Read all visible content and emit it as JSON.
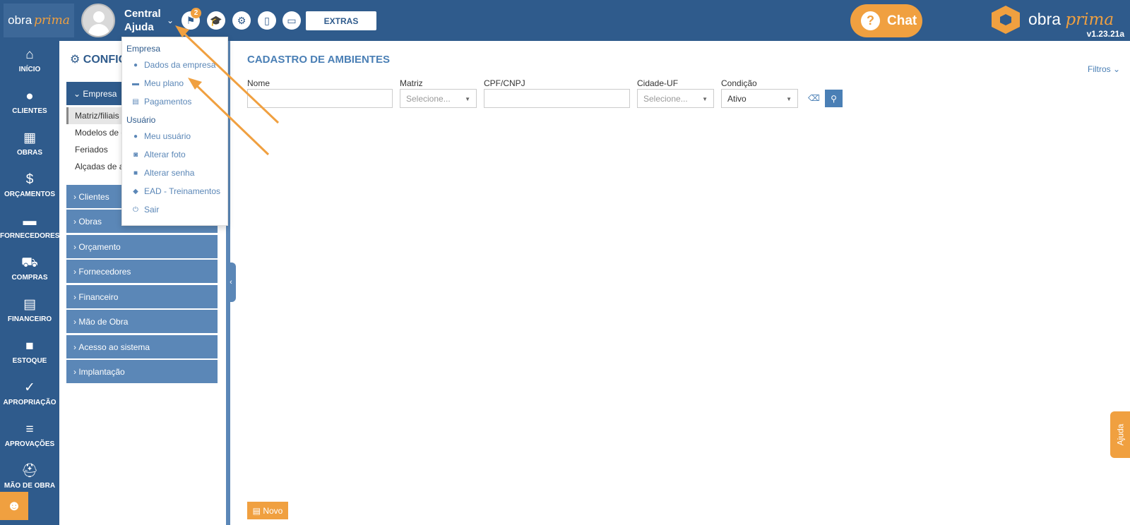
{
  "header": {
    "brand_left": {
      "text": "obra",
      "script": "prima"
    },
    "user": {
      "line1": "Central",
      "line2": "Ajuda"
    },
    "notification_count": "2",
    "extras_label": "EXTRAS",
    "chat_label": "Chat",
    "brand_right": {
      "text": "obra",
      "script": "prima"
    },
    "version": "v1.23.21a"
  },
  "leftnav": [
    {
      "label": "INÍCIO",
      "icon": "home-icon"
    },
    {
      "label": "CLIENTES",
      "icon": "user-icon"
    },
    {
      "label": "OBRAS",
      "icon": "building-icon"
    },
    {
      "label": "ORÇAMENTOS",
      "icon": "budget-doc-icon"
    },
    {
      "label": "FORNECEDORES",
      "icon": "truck-icon"
    },
    {
      "label": "COMPRAS",
      "icon": "cart-icon"
    },
    {
      "label": "FINANCEIRO",
      "icon": "calculator-icon"
    },
    {
      "label": "ESTOQUE",
      "icon": "box-icon"
    },
    {
      "label": "APROPRIAÇÃO",
      "icon": "check-doc-icon"
    },
    {
      "label": "APROVAÇÕES",
      "icon": "list-check-icon"
    },
    {
      "label": "MÃO DE OBRA",
      "icon": "hardhat-icon"
    }
  ],
  "config": {
    "title": "CONFIG",
    "sections": [
      {
        "label": "Empresa",
        "expanded": true
      },
      {
        "label": "Clientes"
      },
      {
        "label": "Obras"
      },
      {
        "label": "Orçamento"
      },
      {
        "label": "Fornecedores"
      },
      {
        "label": "Financeiro"
      },
      {
        "label": "Mão de Obra"
      },
      {
        "label": "Acesso ao sistema"
      },
      {
        "label": "Implantação"
      }
    ],
    "subitems": [
      "Matriz/filiais",
      "Modelos de e",
      "Feriados",
      "Alçadas de a"
    ]
  },
  "main": {
    "title": "CADASTRO DE AMBIENTES",
    "filters_label": "Filtros",
    "fields": {
      "nome": {
        "label": "Nome",
        "value": ""
      },
      "matriz": {
        "label": "Matriz",
        "value": "Selecione..."
      },
      "cpf": {
        "label": "CPF/CNPJ",
        "value": ""
      },
      "cidade": {
        "label": "Cidade-UF",
        "value": "Selecione..."
      },
      "condicao": {
        "label": "Condição",
        "value": "Ativo"
      }
    },
    "novo_label": "Novo",
    "help_label": "Ajuda"
  },
  "dropdown": {
    "empresa_header": "Empresa",
    "usuario_header": "Usuário",
    "items": [
      {
        "label": "Dados da empresa",
        "icon": "person-icon"
      },
      {
        "label": "Meu plano",
        "icon": "monitor-icon"
      },
      {
        "label": "Pagamentos",
        "icon": "document-icon"
      },
      {
        "label": "Meu usuário",
        "icon": "person-icon"
      },
      {
        "label": "Alterar foto",
        "icon": "camera-icon"
      },
      {
        "label": "Alterar senha",
        "icon": "lock-icon"
      },
      {
        "label": "EAD - Treinamentos",
        "icon": "graduation-cap-icon"
      },
      {
        "label": "Sair",
        "icon": "power-icon"
      }
    ]
  },
  "colors": {
    "primary": "#2f5b8c",
    "accent": "#f0a040",
    "section": "#5b87b7",
    "link": "#4a7fb5"
  }
}
